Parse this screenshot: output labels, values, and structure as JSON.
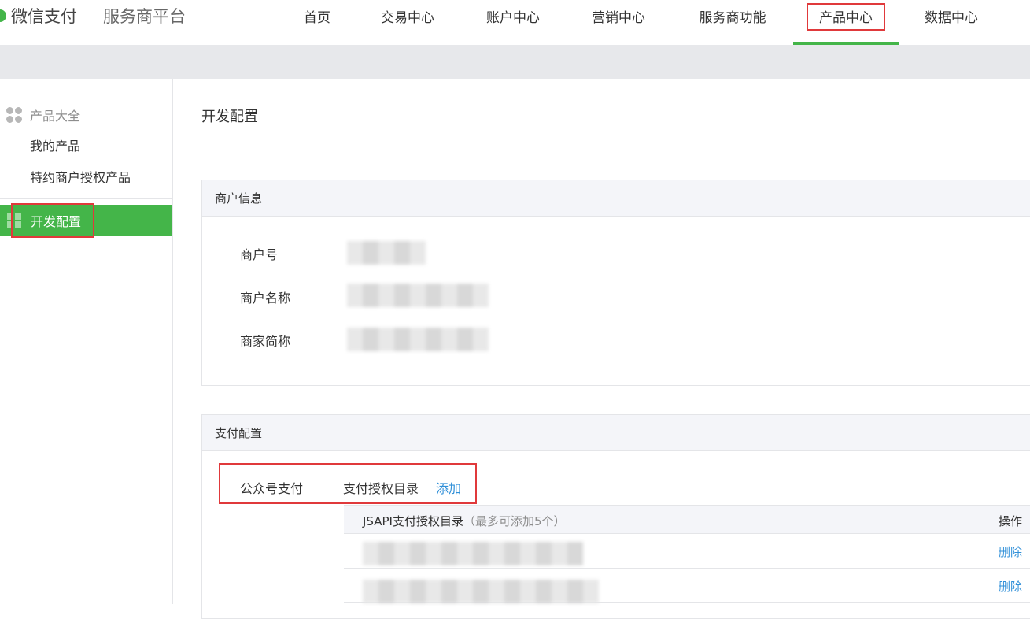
{
  "brand": {
    "name": "微信支付",
    "subtitle": "服务商平台",
    "logo_color": "#44b549"
  },
  "nav": {
    "items": [
      {
        "label": "首页"
      },
      {
        "label": "交易中心"
      },
      {
        "label": "账户中心"
      },
      {
        "label": "营销中心"
      },
      {
        "label": "服务商功能"
      },
      {
        "label": "产品中心",
        "active": true
      },
      {
        "label": "数据中心"
      }
    ]
  },
  "sidebar": {
    "group_title": "产品大全",
    "items": [
      {
        "label": "我的产品"
      },
      {
        "label": "特约商户授权产品"
      }
    ],
    "active_label": "开发配置",
    "accent_color": "#44b549"
  },
  "main": {
    "page_title": "开发配置",
    "merchant_panel": {
      "title": "商户信息",
      "fields": [
        {
          "label": "商户号"
        },
        {
          "label": "商户名称"
        },
        {
          "label": "商家简称"
        }
      ]
    },
    "pay_panel": {
      "title": "支付配置",
      "pay_type": "公众号支付",
      "dir_label": "支付授权目录",
      "add_label": "添加",
      "table": {
        "title": "JSAPI支付授权目录",
        "hint": "（最多可添加5个）",
        "op_header": "操作",
        "rows": [
          {
            "action": "删除"
          },
          {
            "action": "删除"
          }
        ]
      }
    }
  },
  "colors": {
    "highlight_box": "#e0393b",
    "link": "#2f8fd8"
  }
}
